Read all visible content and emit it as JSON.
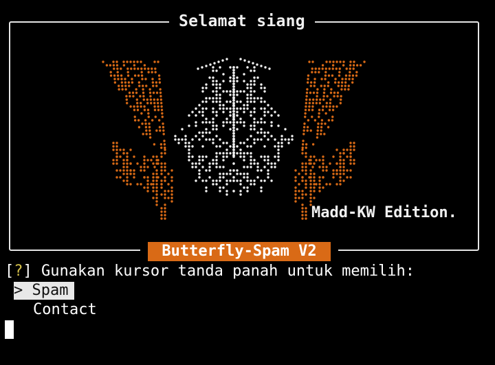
{
  "banner": {
    "title": "Selamat siang",
    "edition": "Madd-KW Edition.",
    "app_name": "Butterfly-Spam V2",
    "art": "butterfly-ascii-art"
  },
  "prompt": {
    "open_bracket": "[",
    "marker": "?",
    "close_bracket": "]",
    "text": " Gunakan kursor tanda panah untuk memilih:"
  },
  "menu": {
    "items": [
      {
        "label": "> Spam",
        "selected": true
      },
      {
        "label": "Contact",
        "selected": false
      }
    ]
  },
  "colors": {
    "background": "#000000",
    "foreground": "#ffffff",
    "accent_orange": "#d96a16",
    "art_white": "#f2f2f2",
    "prompt_marker": "#d7c24a"
  }
}
